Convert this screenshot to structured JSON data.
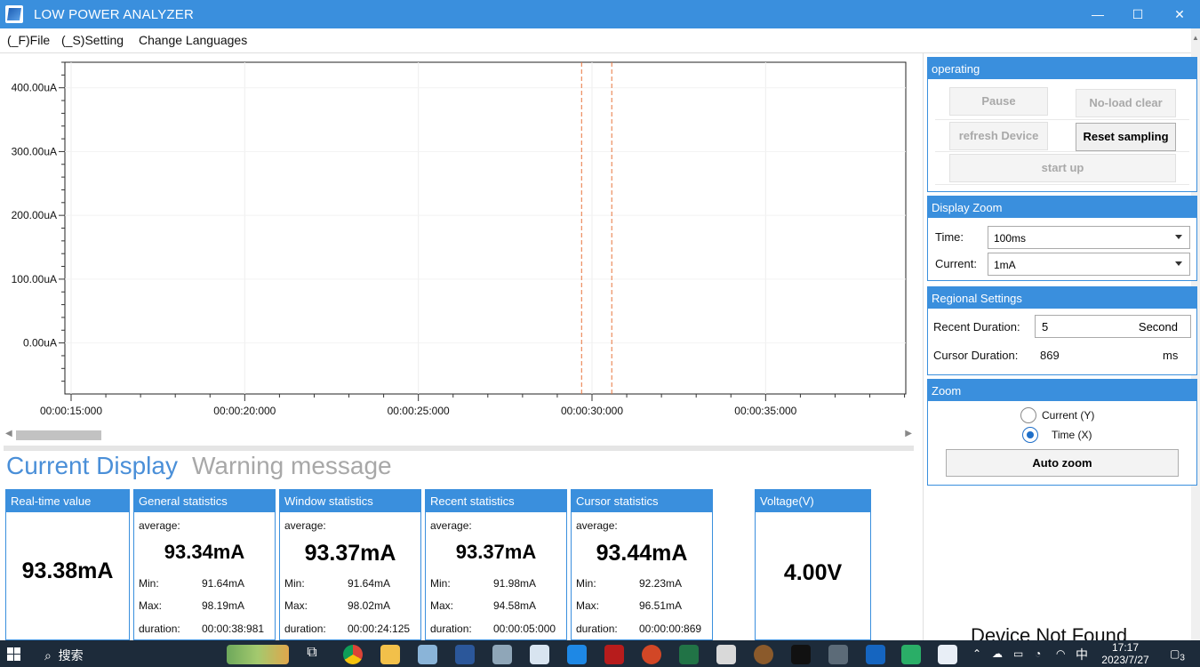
{
  "window": {
    "title": "LOW POWER ANALYZER",
    "controls": {
      "minimize": "—",
      "maximize": "☐",
      "close": "✕"
    }
  },
  "menu": {
    "file": "(_F)File",
    "setting": "(_S)Setting",
    "languages": "Change Languages"
  },
  "chart_data": {
    "type": "line",
    "title": "",
    "xlabel": "",
    "ylabel": "",
    "y_ticks": [
      "400.00uA",
      "300.00uA",
      "200.00uA",
      "100.00uA",
      "0.00uA"
    ],
    "y_tick_values": [
      400,
      300,
      200,
      100,
      0
    ],
    "x_ticks": [
      "00:00:15:000",
      "00:00:20:000",
      "00:00:25:000",
      "00:00:30:000",
      "00:00:35:000"
    ],
    "ylim": [
      -80,
      440
    ],
    "grid": true,
    "series": [],
    "cursor_lines": [
      {
        "x": "00:00:29:700",
        "color": "#e8743b"
      },
      {
        "x": "00:00:30:569",
        "color": "#e8743b"
      }
    ]
  },
  "tabs": {
    "current": "Current Display",
    "warning": "Warning message"
  },
  "stats": {
    "realtime": {
      "title": "Real-time value",
      "value": "93.38mA"
    },
    "general": {
      "title": "General statistics",
      "average_label": "average:",
      "average": "93.34mA",
      "min_label": "Min:",
      "min": "91.64mA",
      "max_label": "Max:",
      "max": "98.19mA",
      "duration_label": "duration:",
      "duration": "00:00:38:981"
    },
    "window": {
      "title": "Window statistics",
      "average_label": "average:",
      "average": "93.37mA",
      "min_label": "Min:",
      "min": "91.64mA",
      "max_label": "Max:",
      "max": "98.02mA",
      "duration_label": "duration:",
      "duration": "00:00:24:125"
    },
    "recent": {
      "title": "Recent statistics",
      "average_label": "average:",
      "average": "93.37mA",
      "min_label": "Min:",
      "min": "91.98mA",
      "max_label": "Max:",
      "max": "94.58mA",
      "duration_label": "duration:",
      "duration": "00:00:05:000"
    },
    "cursor": {
      "title": "Cursor statistics",
      "average_label": "average:",
      "average": "93.44mA",
      "min_label": "Min:",
      "min": "92.23mA",
      "max_label": "Max:",
      "max": "96.51mA",
      "duration_label": "duration:",
      "duration": "00:00:00:869"
    },
    "voltage": {
      "title": "Voltage(V)",
      "value": "4.00V"
    }
  },
  "operating": {
    "title": "operating",
    "pause": "Pause",
    "noload_clear": "No-load clear",
    "refresh_device": "refresh Device",
    "reset_sampling": "Reset sampling",
    "start_up": "start up"
  },
  "display_zoom": {
    "title": "Display Zoom",
    "time_label": "Time:",
    "time_value": "100ms",
    "current_label": "Current:",
    "current_value": "1mA"
  },
  "regional": {
    "title": "Regional Settings",
    "recent_label": "Recent Duration:",
    "recent_value": "5",
    "recent_unit": "Second",
    "cursor_label": "Cursor Duration:",
    "cursor_value": "869",
    "cursor_unit": "ms"
  },
  "zoom": {
    "title": "Zoom",
    "current_option": "Current  (Y)",
    "time_option": "Time  (X)",
    "selected": "time",
    "auto_zoom": "Auto zoom"
  },
  "status_message": "Device Not Found",
  "taskbar": {
    "search_label": "搜索",
    "ime": "中",
    "time": "17:17",
    "date": "2023/7/27",
    "notification_count": "3"
  }
}
